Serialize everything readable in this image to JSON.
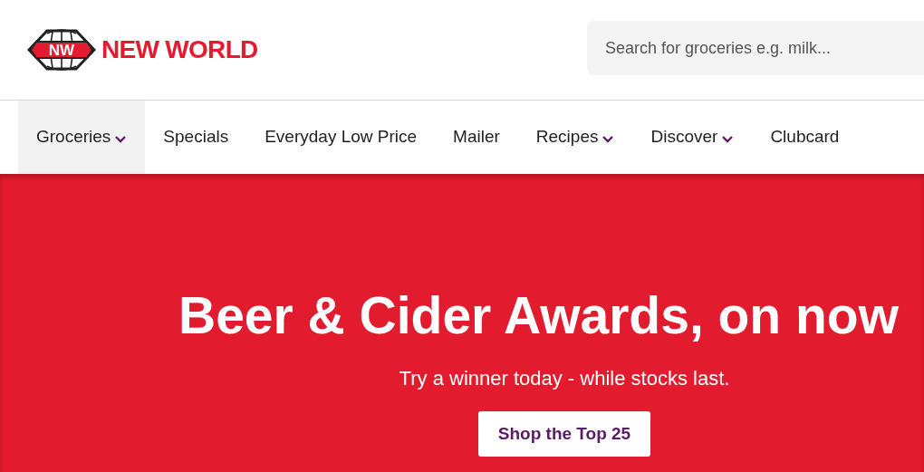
{
  "header": {
    "logo": {
      "badge": "NW",
      "name": "NEW WORLD"
    },
    "search": {
      "placeholder": "Search for groceries e.g. milk..."
    }
  },
  "nav": [
    {
      "label": "Groceries",
      "selected": true,
      "has_menu": true
    },
    {
      "label": "Specials",
      "selected": false,
      "has_menu": false
    },
    {
      "label": "Everyday Low Price",
      "selected": false,
      "has_menu": false
    },
    {
      "label": "Mailer",
      "selected": false,
      "has_menu": false
    },
    {
      "label": "Recipes",
      "selected": false,
      "has_menu": true
    },
    {
      "label": "Discover",
      "selected": false,
      "has_menu": true
    },
    {
      "label": "Clubcard",
      "selected": false,
      "has_menu": false
    }
  ],
  "hero": {
    "title": "Beer & Cider Awards, on now",
    "subtitle": "Try a winner today - while stocks last.",
    "button": "Shop the Top 25"
  }
}
